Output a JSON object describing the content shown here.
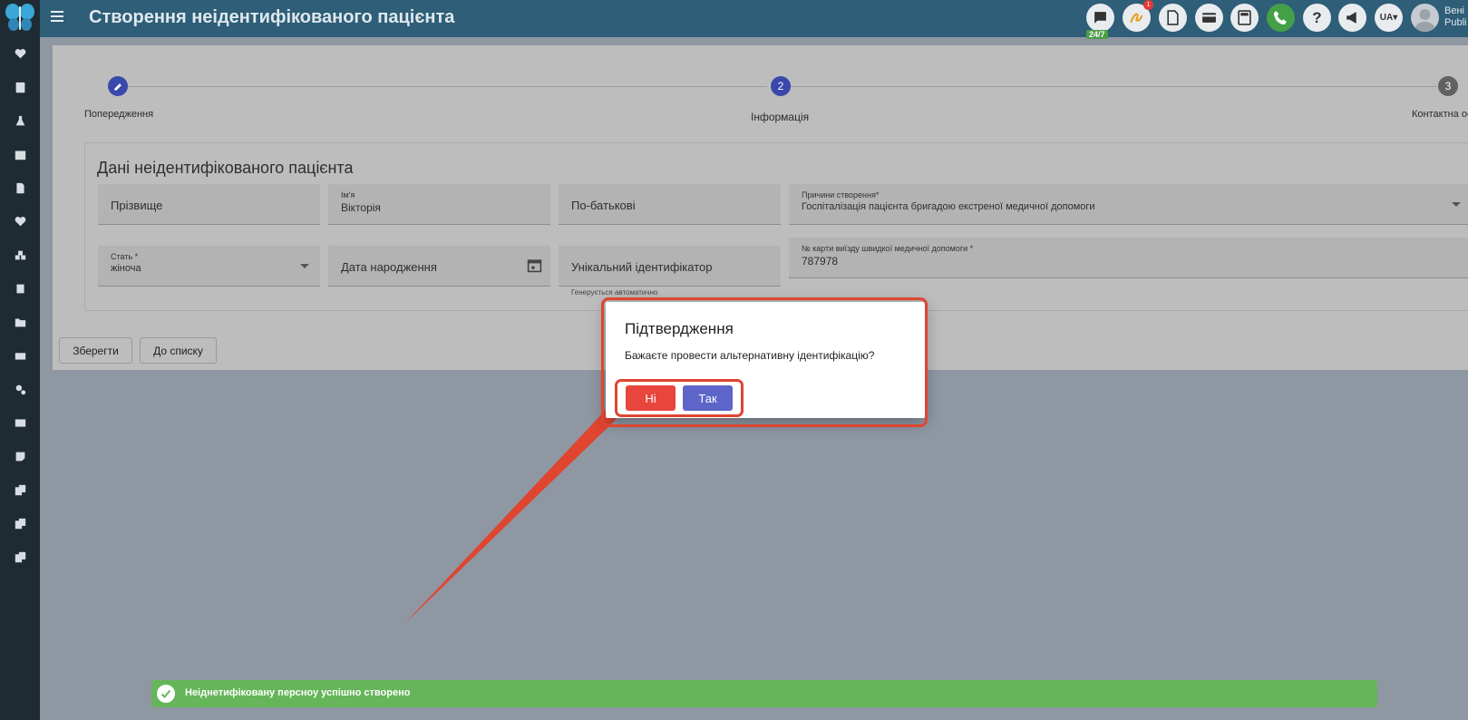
{
  "header": {
    "title": "Створення неідентифікованого пацієнта",
    "support_badge": "24/7",
    "notification_count": "1",
    "language": "UA",
    "user_line1": "Вені",
    "user_line2": "Publi"
  },
  "stepper": {
    "steps": [
      {
        "number": "",
        "label": "Попередження"
      },
      {
        "number": "2",
        "label": "Інформація"
      },
      {
        "number": "3",
        "label": "Контактна ос"
      }
    ]
  },
  "form": {
    "section_title": "Дані неідентифікованого пацієнта",
    "surname": {
      "placeholder": "Прізвище"
    },
    "first_name": {
      "label": "Ім'я",
      "value": "Вікторія"
    },
    "patronymic": {
      "placeholder": "По-батькові"
    },
    "reason": {
      "label": "Причини створення*",
      "value": "Госпіталізація пацієнта бригадою екстреної медичної допомоги"
    },
    "gender": {
      "label": "Стать *",
      "value": "жіноча"
    },
    "birth_date": {
      "placeholder": "Дата народження"
    },
    "unique_id": {
      "placeholder": "Унікальний ідентифікатор",
      "hint": "Генерується автоматично"
    },
    "ambulance_card": {
      "label": "№ карти виїзду швидкої медичної допомоги *",
      "value": "787978"
    }
  },
  "actions": {
    "save": "Зберегти",
    "to_list": "До списку"
  },
  "dialog": {
    "title": "Підтвердження",
    "message": "Бажаєте провести альтернативну ідентифікацію?",
    "no": "Ні",
    "yes": "Так"
  },
  "toast": {
    "message": "Неіднетифіковану персноу успішно створено"
  },
  "colors": {
    "topbar": "#2e5e78",
    "sidebar": "#1f2b33",
    "no_button": "#e8453c",
    "yes_button": "#5d66c8",
    "highlight": "#e0452f",
    "toast": "#66b55a",
    "step_active": "#3949ab",
    "step_inactive": "#616161"
  }
}
